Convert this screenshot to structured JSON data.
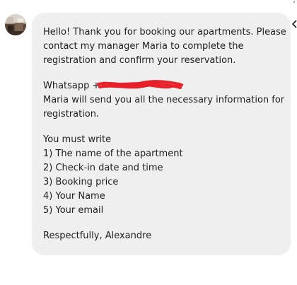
{
  "message": {
    "lines": [
      "Hello! Thank you for booking our apartments. Please",
      "contact my manager Maria to complete the",
      "registration and confirm your reservation.",
      "Whatsapp +",
      "Maria will send you all the necessary information for",
      "registration.",
      "You must write",
      "1) The name of the apartment",
      "2) Check-in date and time",
      "3) Booking price",
      "4) Your Name",
      "5) Your email",
      "Respectfully, Alexandre"
    ]
  },
  "icons": {
    "avatar": "avatar",
    "redaction": "red-scribble",
    "corner": "chevron-left-icon"
  },
  "colors": {
    "bubble_bg": "#efefef",
    "text": "#1c1e21",
    "redaction": "#e8202a",
    "link": "#385898"
  }
}
